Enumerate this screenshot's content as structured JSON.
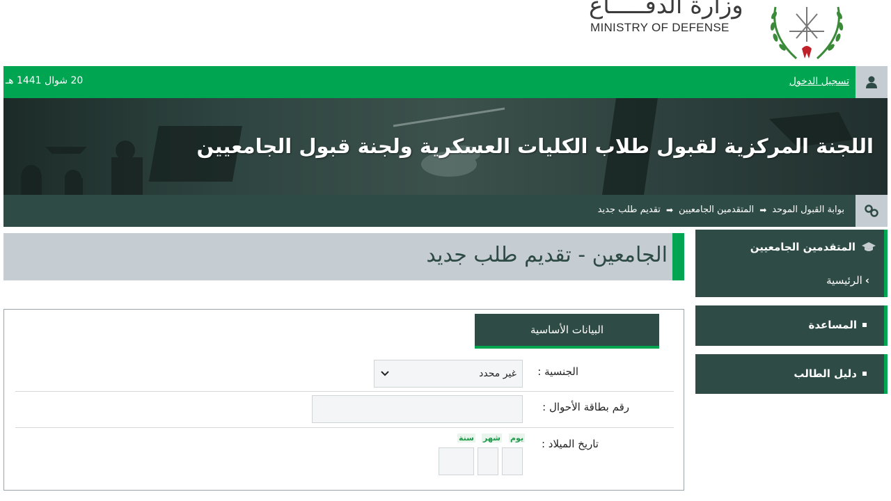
{
  "header": {
    "ministry_ar": "وزارة الدفـــــاع",
    "ministry_en": "MINISTRY OF DEFENSE",
    "login_label": "تسجيل الدخول",
    "hijri_date": "20 شوال 1441 هـ"
  },
  "banner": {
    "title": "اللجنة المركزية لقبول طلاب الكليات العسكرية ولجنة قبول الجامعيين"
  },
  "breadcrumb": {
    "items": [
      "بوابة القبول الموحد",
      "المتقدمين الجامعيين",
      "تقديم طلب جديد"
    ],
    "separator": "➡"
  },
  "page": {
    "title": "الجامعين - تقديم طلب جديد"
  },
  "sidebar": {
    "section_title": "المتقدمين الجامعيين",
    "home_label": "الرئيسية",
    "help_label": "المساعدة",
    "guide_label": "دليل الطالب"
  },
  "form": {
    "tab_label": "البيانات الأساسية",
    "nationality_label": "الجنسية :",
    "nationality_value": "غير محدد",
    "id_label": "رقم بطاقة الأحوال :",
    "dob_label": "تاريخ الميلاد :",
    "day_label": "يوم",
    "month_label": "شهر",
    "year_label": "سنة"
  },
  "colors": {
    "green": "#00a551",
    "dark_teal": "#2f4b45",
    "gray": "#c5ccd2"
  }
}
